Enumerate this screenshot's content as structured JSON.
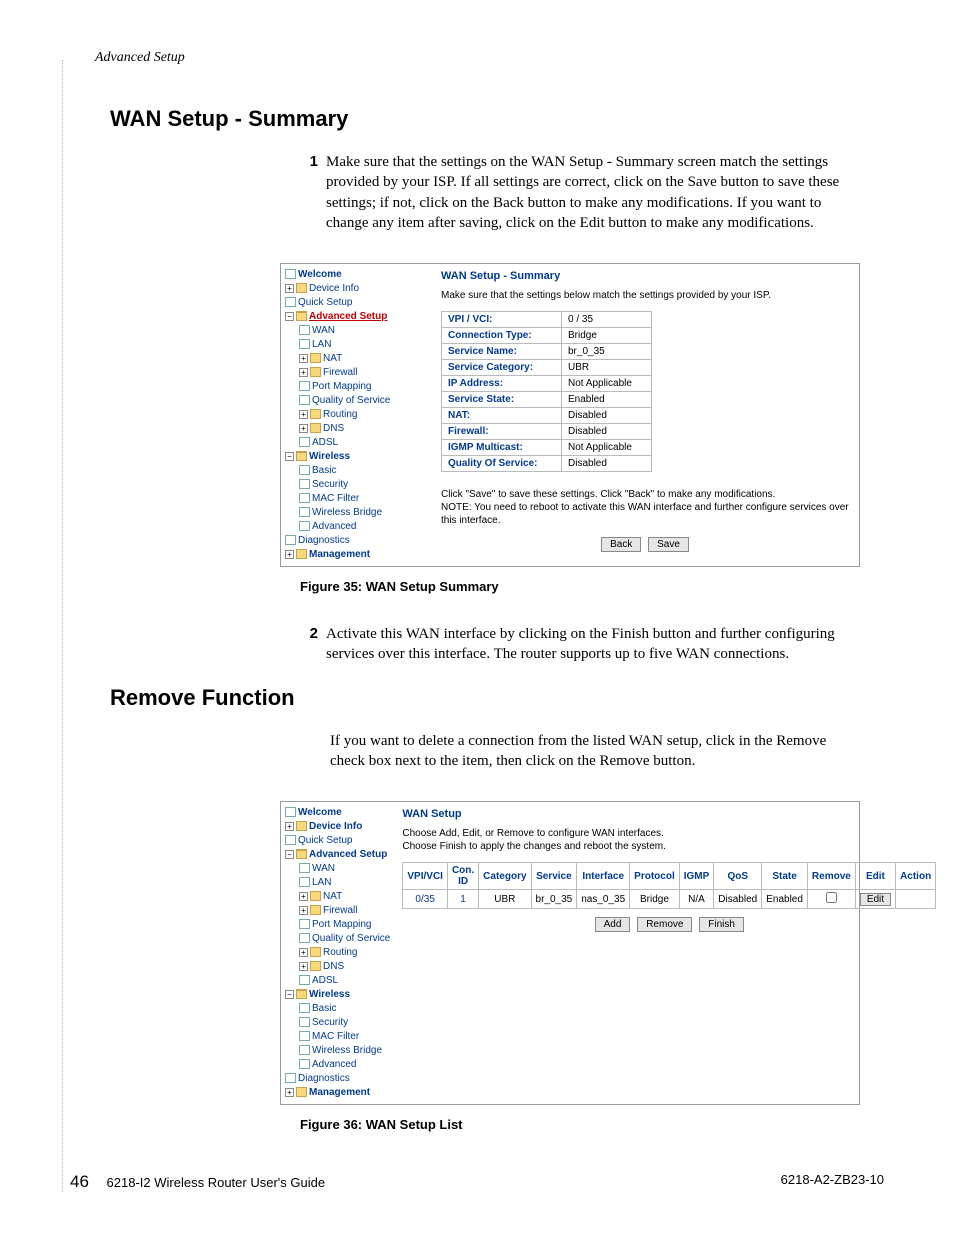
{
  "header_section": "Advanced Setup",
  "sections": {
    "wan_summary": {
      "title": "WAN Setup - Summary",
      "step1_num": "1",
      "step1_text": "Make sure that the settings on the WAN Setup - Summary screen match the settings provided by your ISP. If all settings are correct, click on the Save button to save these settings; if not, click on the Back button to make any modifications. If you want to change any item after saving, click on the Edit button to make any modifications.",
      "step2_num": "2",
      "step2_text": "Activate this WAN interface by clicking on the Finish button and further configuring services over this interface. The router supports up to five WAN connections."
    },
    "remove_function": {
      "title": "Remove Function",
      "para": "If you want to delete a connection from the listed WAN setup, click in the Remove check box next to the item, then click on the Remove button."
    }
  },
  "figure35": {
    "caption": "Figure 35: WAN Setup Summary",
    "panel_title": "WAN Setup - Summary",
    "panel_sub": "Make sure that the settings below match the settings provided by your ISP.",
    "rows": [
      {
        "k": "VPI / VCI:",
        "v": "0 / 35"
      },
      {
        "k": "Connection Type:",
        "v": "Bridge"
      },
      {
        "k": "Service Name:",
        "v": "br_0_35"
      },
      {
        "k": "Service Category:",
        "v": "UBR"
      },
      {
        "k": "IP Address:",
        "v": "Not Applicable"
      },
      {
        "k": "Service State:",
        "v": "Enabled"
      },
      {
        "k": "NAT:",
        "v": "Disabled"
      },
      {
        "k": "Firewall:",
        "v": "Disabled"
      },
      {
        "k": "IGMP Multicast:",
        "v": "Not Applicable"
      },
      {
        "k": "Quality Of Service:",
        "v": "Disabled"
      }
    ],
    "note1": "Click \"Save\" to save these settings. Click \"Back\" to make any modifications.",
    "note2": "NOTE: You need to reboot to activate this WAN interface and further configure services over this interface.",
    "btn_back": "Back",
    "btn_save": "Save"
  },
  "figure36": {
    "caption": "Figure 36: WAN Setup List",
    "panel_title": "WAN Setup",
    "panel_sub1": "Choose Add, Edit, or Remove to configure WAN interfaces.",
    "panel_sub2": "Choose Finish to apply the changes and reboot the system.",
    "headers": [
      "VPI/VCI",
      "Con. ID",
      "Category",
      "Service",
      "Interface",
      "Protocol",
      "IGMP",
      "QoS",
      "State",
      "Remove",
      "Edit",
      "Action"
    ],
    "row": {
      "vpivci": "0/35",
      "conid": "1",
      "category": "UBR",
      "service": "br_0_35",
      "interface": "nas_0_35",
      "protocol": "Bridge",
      "igmp": "N/A",
      "qos": "Disabled",
      "state": "Enabled",
      "edit_label": "Edit"
    },
    "btn_add": "Add",
    "btn_remove": "Remove",
    "btn_finish": "Finish"
  },
  "nav": {
    "welcome": "Welcome",
    "device_info": "Device Info",
    "quick_setup": "Quick Setup",
    "advanced_setup": "Advanced Setup",
    "wan": "WAN",
    "lan": "LAN",
    "nat": "NAT",
    "firewall": "Firewall",
    "port_mapping": "Port Mapping",
    "qos": "Quality of Service",
    "routing": "Routing",
    "dns": "DNS",
    "adsl": "ADSL",
    "wireless": "Wireless",
    "basic": "Basic",
    "security": "Security",
    "mac_filter": "MAC Filter",
    "wireless_bridge": "Wireless Bridge",
    "advanced": "Advanced",
    "diagnostics": "Diagnostics",
    "management": "Management"
  },
  "footer": {
    "page": "46",
    "left": "6218-I2 Wireless Router User's Guide",
    "right": "6218-A2-ZB23-10"
  }
}
